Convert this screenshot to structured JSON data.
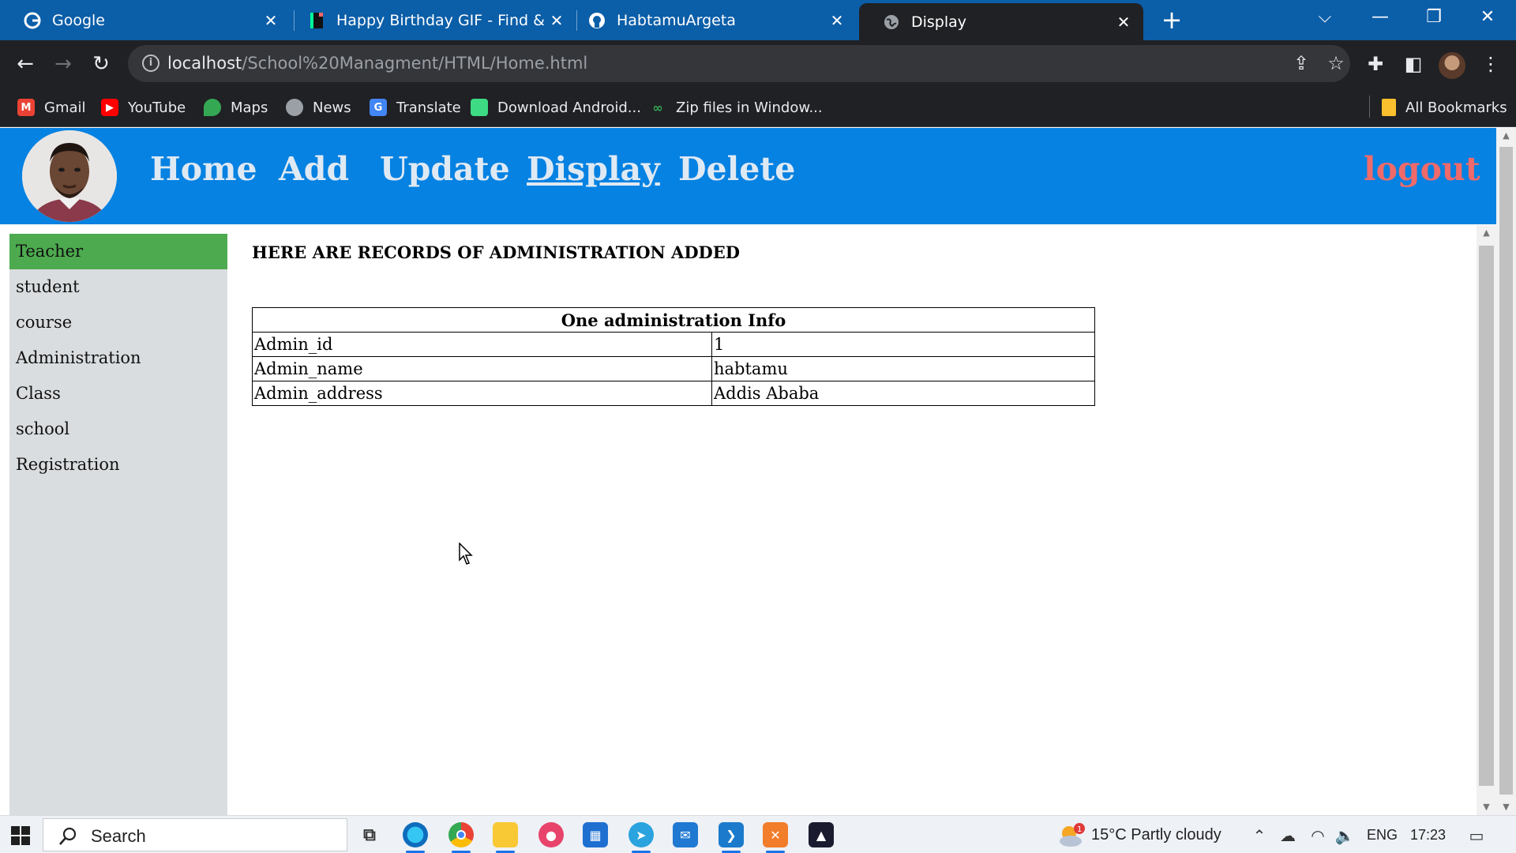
{
  "browser": {
    "tabs": [
      {
        "title": "Google",
        "favicon": "google-icon",
        "active": false
      },
      {
        "title": "Happy Birthday GIF - Find & Sha",
        "favicon": "giphy-icon",
        "active": false
      },
      {
        "title": "HabtamuArgeta",
        "favicon": "github-icon",
        "active": false
      },
      {
        "title": "Display",
        "favicon": "globe-icon",
        "active": true
      }
    ],
    "url_host": "localhost",
    "url_path": "/School%20Managment/HTML/Home.html",
    "bookmarks": [
      {
        "label": "Gmail",
        "icon": "gmail-icon",
        "color": "#ea4335"
      },
      {
        "label": "YouTube",
        "icon": "youtube-icon",
        "color": "#ff0000"
      },
      {
        "label": "Maps",
        "icon": "maps-icon",
        "color": "#34a853"
      },
      {
        "label": "News",
        "icon": "news-icon",
        "color": "#9aa0a6"
      },
      {
        "label": "Translate",
        "icon": "translate-icon",
        "color": "#4285f4"
      },
      {
        "label": "Download Android...",
        "icon": "android-icon",
        "color": "#3ddc84"
      },
      {
        "label": "Zip files in Window...",
        "icon": "link-icon",
        "color": "#34a853"
      }
    ],
    "all_bookmarks": "All Bookmarks"
  },
  "header": {
    "nav": [
      "Home",
      "Add",
      "Update",
      "Display",
      "Delete"
    ],
    "current": "Display",
    "logout": "logout",
    "colors": {
      "bar": "#0582e2",
      "link": "#dfe9f3",
      "logout": "#ef6a6a"
    }
  },
  "sidebar": {
    "items": [
      "Teacher",
      "student",
      "course",
      "Administration",
      "Class",
      "school",
      "Registration"
    ],
    "active": "Teacher",
    "active_color": "#4daa4f"
  },
  "main": {
    "heading": "HERE ARE RECORDS OF ADMINISTRATION ADDED",
    "table": {
      "caption": "One administration Info",
      "rows": [
        {
          "key": "Admin_id",
          "value": "1"
        },
        {
          "key": "Admin_name",
          "value": "habtamu"
        },
        {
          "key": "Admin_address",
          "value": "Addis Ababa"
        }
      ]
    }
  },
  "taskbar": {
    "search_placeholder": "Search",
    "weather": "15°C  Partly cloudy",
    "weather_badge": "1",
    "language": "ENG",
    "time": "17:23",
    "apps": [
      "task-view-icon",
      "edge-icon",
      "chrome-icon",
      "file-explorer-icon",
      "recorder-icon",
      "store-icon",
      "telegram-icon",
      "mail-icon",
      "vscode-icon",
      "xampp-icon",
      "adobe-icon"
    ]
  }
}
